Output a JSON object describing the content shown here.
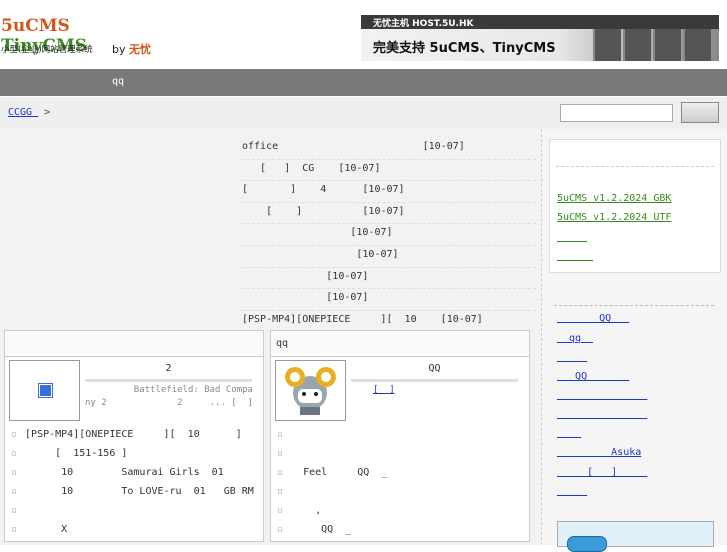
{
  "header": {
    "logo_line1": "5uCMS",
    "logo_line1b": "TinyCMS",
    "logo_line2": "小型(企业)网站管理系统",
    "logo_by": "by",
    "logo_brand": "无忧",
    "banner_top": "无忧主机  HOST.5U.HK",
    "banner_main": "完美支持 5uCMS、TinyCMS"
  },
  "nav": {
    "item": "qq"
  },
  "breadcrumb": {
    "link": "CCGG   ",
    "sep": ">"
  },
  "search": {
    "placeholder": "",
    "button": ""
  },
  "list": [
    "office                        [10-07]",
    "   [   ]  CG    [10-07]",
    "[       ]    4      [10-07]",
    "    [    ]          [10-07]",
    "                  [10-07]",
    "                   [10-07]",
    "              [10-07]",
    "              [10-07]",
    "[PSP-MP4][ONEPIECE     ][  10    [10-07]"
  ],
  "box1": {
    "title": "",
    "item_title": "2",
    "item_desc_1": "         Battlefield: Bad Compa",
    "item_desc_2": "ny 2             2     ... [  ]",
    "items": [
      "[PSP-MP4][ONEPIECE     ][  10      ]",
      "     [  151-156 ]",
      "      10        Samurai Girls  01",
      "      10        To LOVE-ru  01   GB RM",
      "",
      "      X"
    ]
  },
  "box2": {
    "title": "qq",
    "item_title": "QQ",
    "item_desc": "[  ]",
    "items": [
      "",
      "",
      "  Feel     QQ  _",
      "",
      "    ,",
      "     QQ  _"
    ]
  },
  "sidebar": {
    "box1_links": [
      "5uCMS v1.2.2024 GBK",
      "5uCMS v1.2.2024 UTF",
      "     ",
      "      "
    ],
    "box2_links": [
      "       QQ   ",
      "  qq  ",
      "     ",
      "   QQ       ",
      "               ",
      "               ",
      "    ",
      "         Asuka",
      "     [   ]     ",
      "     "
    ]
  }
}
